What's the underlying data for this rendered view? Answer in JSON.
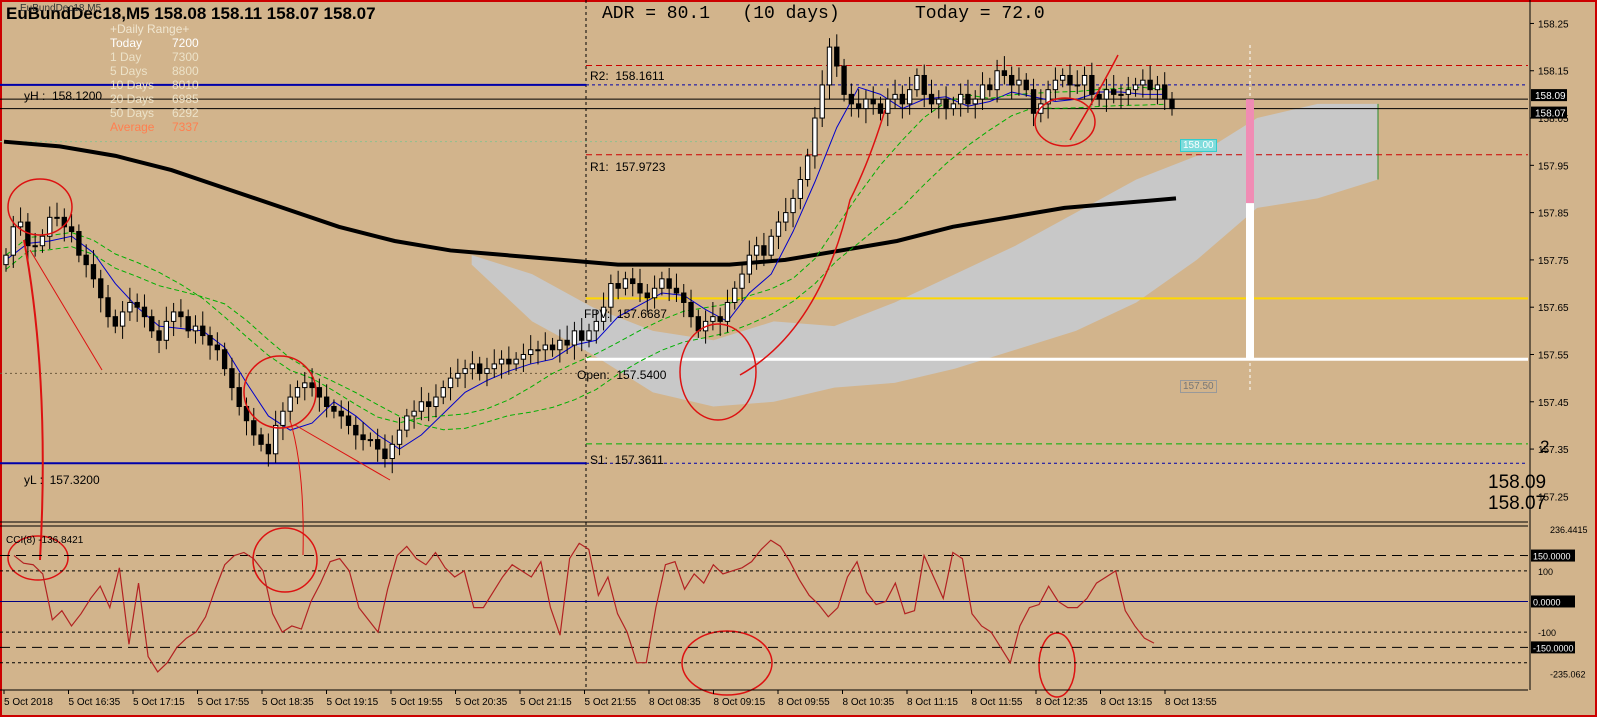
{
  "header": {
    "title": "EuBundDec18,M5  158.08 158.11 158.07 158.07",
    "small_title": "EuBundDec18,M5",
    "adr": "ADR = 80.1   (10 days)",
    "today": "Today = 72.0"
  },
  "daily_range": {
    "heading": "+Daily Range+",
    "rows": [
      {
        "label": "Today",
        "value": "7200"
      },
      {
        "label": "1 Day",
        "value": "7300"
      },
      {
        "label": "5 Days",
        "value": "8800"
      },
      {
        "label": "10 Days",
        "value": "8010"
      },
      {
        "label": "20 Days",
        "value": "6985"
      },
      {
        "label": "50 Days",
        "value": "6292"
      },
      {
        "label": "Average",
        "value": "7337"
      }
    ]
  },
  "levels": {
    "yh": "yH :  158.1200",
    "yl": "yL :  157.3200",
    "r2": "R2:  158.1611",
    "r1": "R1:  157.9723",
    "fpv": "FPV:  157.6687",
    "open": "Open:  157.5400",
    "s1": "S1:  157.3611",
    "tag_158": "158.00",
    "tag_157_50": "157.50",
    "marker_2": "2"
  },
  "price_readout": {
    "bid": "158.09",
    "ask": "158.07"
  },
  "price_badges": {
    "bid": "158.09",
    "ask": "158.07"
  },
  "cci": {
    "label": "CCI(8) -136.8421",
    "badges": [
      "150.0000",
      "0.0000",
      "-150.0000"
    ],
    "top_value": "236.4415",
    "bottom_value": "-235.062"
  },
  "colors": {
    "background": "#d2b48c",
    "bull_candle": "#ffffff",
    "bear_candle": "#000000",
    "ma_thick": "#000000",
    "kijun": "#0000cc",
    "ma_green": "#00b000",
    "cloud": "#c8c8c8",
    "pivot_red": "#cc0000",
    "yh_yl": "#0000aa",
    "fpv": "#ffd700",
    "annotation": "#dd1111",
    "cci_line": "#b22222"
  },
  "chart_data": {
    "type": "candlestick",
    "symbol": "EuBundDec18",
    "timeframe": "M5",
    "ylim": [
      157.2,
      158.27
    ],
    "y_ticks": [
      "158.25",
      "158.15",
      "158.05",
      "157.95",
      "157.85",
      "157.75",
      "157.65",
      "157.55",
      "157.45",
      "157.35",
      "157.25"
    ],
    "x_ticks": [
      "5 Oct 2018",
      "5 Oct 16:35",
      "5 Oct 17:15",
      "5 Oct 17:55",
      "5 Oct 18:35",
      "5 Oct 19:15",
      "5 Oct 19:55",
      "5 Oct 20:35",
      "5 Oct 21:15",
      "5 Oct 21:55",
      "8 Oct 08:35",
      "8 Oct 09:15",
      "8 Oct 09:55",
      "8 Oct 10:35",
      "8 Oct 11:15",
      "8 Oct 11:55",
      "8 Oct 12:35",
      "8 Oct 13:15",
      "8 Oct 13:55"
    ],
    "close": [
      157.76,
      157.82,
      157.83,
      157.78,
      157.78,
      157.8,
      157.84,
      157.84,
      157.82,
      157.81,
      157.76,
      157.74,
      157.71,
      157.67,
      157.63,
      157.61,
      157.64,
      157.66,
      157.65,
      157.63,
      157.6,
      157.58,
      157.62,
      157.64,
      157.63,
      157.6,
      157.61,
      157.59,
      157.57,
      157.56,
      157.52,
      157.48,
      157.44,
      157.41,
      157.38,
      157.36,
      157.34,
      157.4,
      157.43,
      157.46,
      157.48,
      157.49,
      157.48,
      157.46,
      157.44,
      157.43,
      157.42,
      157.4,
      157.38,
      157.37,
      157.37,
      157.35,
      157.33,
      157.36,
      157.39,
      157.42,
      157.43,
      157.45,
      157.44,
      157.46,
      157.48,
      157.5,
      157.51,
      157.52,
      157.53,
      157.51,
      157.52,
      157.53,
      157.54,
      157.53,
      157.54,
      157.55,
      157.56,
      157.56,
      157.57,
      157.56,
      157.58,
      157.57,
      157.6,
      157.58,
      157.6,
      157.62,
      157.65,
      157.7,
      157.69,
      157.71,
      157.7,
      157.68,
      157.67,
      157.69,
      157.71,
      157.69,
      157.68,
      157.66,
      157.63,
      157.6,
      157.62,
      157.63,
      157.62,
      157.66,
      157.69,
      157.72,
      157.76,
      157.78,
      157.76,
      157.8,
      157.83,
      157.85,
      157.88,
      157.92,
      157.97,
      158.05,
      158.12,
      158.2,
      158.16,
      158.1,
      158.08,
      158.07,
      158.09,
      158.08,
      158.06,
      158.09,
      158.1,
      158.08,
      158.11,
      158.14,
      158.1,
      158.08,
      158.09,
      158.07,
      158.08,
      158.1,
      158.08,
      158.09,
      158.12,
      158.11,
      158.15,
      158.14,
      158.12,
      158.13,
      158.11,
      158.06,
      158.08,
      158.11,
      158.13,
      158.14,
      158.12,
      158.12,
      158.14,
      158.1,
      158.09,
      158.11,
      158.1,
      158.1,
      158.11,
      158.12,
      158.13,
      158.11,
      158.12,
      158.09,
      158.07
    ],
    "ohlc_note": "each candle opens at previous close",
    "moving_average_200": [
      158.0,
      157.99,
      157.97,
      157.94,
      157.9,
      157.86,
      157.82,
      157.79,
      157.77,
      157.76,
      157.75,
      157.74,
      157.74,
      157.74,
      157.75,
      157.77,
      157.79,
      157.82,
      157.84,
      157.86,
      157.87,
      157.88
    ],
    "ichimoku_cloud_top": [
      null,
      null,
      null,
      null,
      157.76,
      157.72,
      157.65,
      157.6,
      157.58,
      157.62,
      157.61,
      157.66,
      157.72,
      157.78,
      157.85,
      157.92,
      157.97,
      158.05,
      158.08,
      158.08
    ],
    "ichimoku_cloud_bottom": [
      null,
      null,
      null,
      null,
      157.74,
      157.62,
      157.55,
      157.47,
      157.44,
      157.45,
      157.48,
      157.49,
      157.52,
      157.56,
      157.6,
      157.66,
      157.75,
      157.86,
      157.88,
      157.92
    ],
    "cci": {
      "name": "CCI(8)",
      "ylim": [
        -250,
        240
      ],
      "levels": [
        150,
        100,
        0,
        -100,
        -150,
        -200
      ],
      "values": [
        150,
        125,
        120,
        90,
        -60,
        -30,
        -80,
        -40,
        10,
        50,
        -20,
        110,
        -140,
        60,
        -180,
        -230,
        -200,
        -150,
        -120,
        -100,
        -50,
        40,
        120,
        150,
        160,
        140,
        100,
        -40,
        -100,
        -80,
        -90,
        0,
        60,
        130,
        140,
        100,
        -20,
        -60,
        -100,
        40,
        150,
        180,
        140,
        120,
        160,
        110,
        80,
        100,
        -20,
        -20,
        30,
        80,
        120,
        100,
        80,
        130,
        -20,
        -110,
        140,
        190,
        170,
        20,
        80,
        -40,
        -100,
        -200,
        -200,
        -20,
        120,
        130,
        40,
        90,
        60,
        120,
        90,
        100,
        110,
        130,
        170,
        200,
        180,
        130,
        70,
        20,
        -10,
        -50,
        -20,
        80,
        130,
        30,
        -10,
        0,
        60,
        -40,
        -30,
        150,
        80,
        10,
        160,
        140,
        -40,
        -80,
        -100,
        -150,
        -200,
        -80,
        -20,
        -10,
        50,
        0,
        -20,
        -20,
        10,
        60,
        80,
        100,
        -30,
        -80,
        -120,
        -136
      ]
    },
    "annotations": [
      "circle peaks",
      "trend lines"
    ]
  }
}
